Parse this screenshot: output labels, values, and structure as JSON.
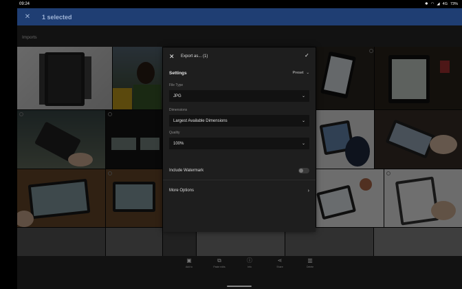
{
  "status_bar": {
    "time": "09:24",
    "indicators": [
      "bluetooth-icon",
      "wifi-icon",
      "signal-icon"
    ],
    "network": "4G",
    "battery": "73%"
  },
  "appbar": {
    "title": "1 selected",
    "close_icon": "close-icon"
  },
  "section": {
    "label": "Imports"
  },
  "dialog": {
    "title": "Export as... (1)",
    "settings_label": "Settings",
    "preset_label": "Preset",
    "file_type": {
      "label": "File Type",
      "value": "JPG"
    },
    "dimensions": {
      "label": "Dimensions",
      "value": "Largest Available Dimensions"
    },
    "quality": {
      "label": "Quality",
      "value": "100%"
    },
    "watermark": {
      "label": "Include Watermark",
      "enabled": false
    },
    "more_options": "More Options"
  },
  "bottom_actions": [
    {
      "label": "Add to",
      "icon": "add-to-album-icon"
    },
    {
      "label": "Paste edits",
      "icon": "paste-edits-icon"
    },
    {
      "label": "Info",
      "icon": "info-icon"
    },
    {
      "label": "Share",
      "icon": "share-icon"
    },
    {
      "label": "Delete",
      "icon": "trash-icon"
    }
  ],
  "colors": {
    "appbar_bg": "#1f3e73",
    "dialog_bg": "#1e1e1e",
    "dropdown_bg": "#121212"
  }
}
